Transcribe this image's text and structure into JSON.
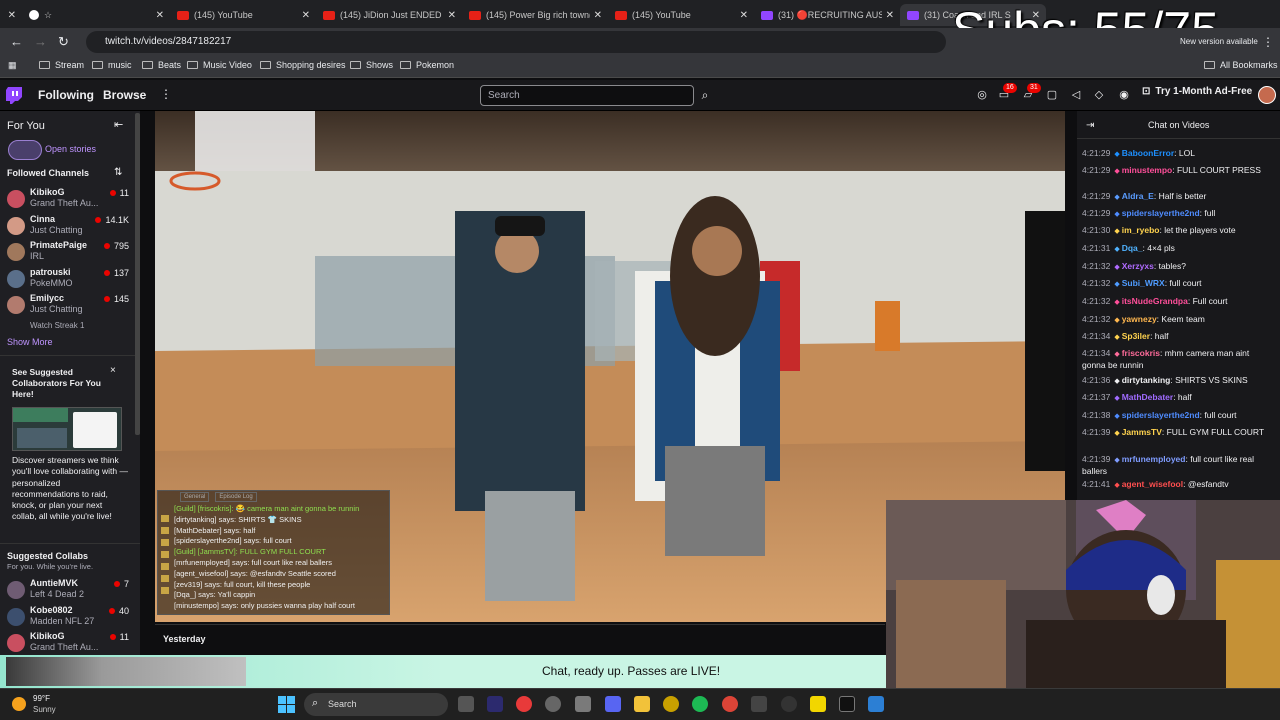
{
  "browser": {
    "tabs": [
      {
        "label": "",
        "kind": "blank"
      },
      {
        "label": "☆",
        "kind": "github"
      },
      {
        "label": "(145) YouTube",
        "kind": "youtube"
      },
      {
        "label": "(145) JiDion Just ENDED Hi",
        "kind": "youtube"
      },
      {
        "label": "(145) Power Big rich town(",
        "kind": "youtube"
      },
      {
        "label": "(145) YouTube",
        "kind": "youtube"
      },
      {
        "label": "(31) 🔴RECRUITING AUSTIN",
        "kind": "twitch"
      },
      {
        "label": "(31) Coach and IRL S",
        "kind": "twitch"
      }
    ],
    "subs_overlay": "Subs: 55/75",
    "new_version": "New version available",
    "url": "twitch.tv/videos/2847182217",
    "bookmarks": [
      "Stream",
      "music",
      "Beats",
      "Music Video",
      "Shopping desires",
      "Shows",
      "Pokemon"
    ],
    "all_bookmarks": "All Bookmarks"
  },
  "twitch_nav": {
    "following": "Following",
    "browse": "Browse",
    "search_placeholder": "Search",
    "notif_inbox": "16",
    "notif_whispers": "31",
    "ad_free": "Try 1-Month Ad-Free"
  },
  "sidebar": {
    "for_you": "For You",
    "open_stories": "Open stories",
    "followed_header": "Followed Channels",
    "followed": [
      {
        "name": "KibikoG",
        "game": "Grand Theft Au...",
        "viewers": "11",
        "color": "#c94f60"
      },
      {
        "name": "Cinna",
        "game": "Just Chatting",
        "viewers": "14.1K",
        "color": "#d39a86"
      },
      {
        "name": "PrimatePaige",
        "game": "IRL",
        "viewers": "795",
        "color": "#a0785c"
      },
      {
        "name": "patrouski",
        "game": "PokeMMO",
        "viewers": "137",
        "color": "#5a6f8a"
      },
      {
        "name": "Emilycc",
        "game": "Just Chatting",
        "viewers": "145",
        "color": "#b27b6e"
      }
    ],
    "watch_streak": "Watch Streak 1",
    "show_more": "Show More",
    "suggest_title": "See Suggested Collaborators For You Here!",
    "suggest_body": "Discover streamers we think you'll love collaborating with — personalized recommendations to raid, knock, or plan your next collab, all while you're live!",
    "suggested_collabs": "Suggested Collabs",
    "suggested_sub": "For you. While you're live.",
    "collabs": [
      {
        "name": "AuntieMVK",
        "game": "Left 4 Dead 2",
        "viewers": "7",
        "color": "#6f5c73"
      },
      {
        "name": "Kobe0802",
        "game": "Madden NFL 27",
        "viewers": "40",
        "color": "#3c4f6e"
      },
      {
        "name": "KibikoG",
        "game": "Grand Theft Au...",
        "viewers": "11",
        "color": "#c94f60"
      }
    ]
  },
  "overlay_chat": {
    "tabs": [
      "General",
      "Episode Log"
    ],
    "lines": [
      "[Guild] [friscokris]: 😂 camera man aint gonna be runnin",
      "[dirtytanking] says: SHIRTS 👕 SKINS",
      "[MathDebater] says: half",
      "[spiderslayerthe2nd] says: full court",
      "[Guild] [JammsTV]: FULL GYM FULL COURT",
      "[mrfunemployed] says: full court like real ballers",
      "[agent_wisefool] says: @esfandtv Seattle scored",
      "[zev319] says: full court, kill these people",
      "[Dqa_] says: Ya'll cappin",
      "[minustempo] says: only pussies wanna play half court"
    ]
  },
  "chat": {
    "title": "Chat on Videos",
    "messages": [
      {
        "ts": "4:21:29",
        "user": "BaboonError",
        "text": "LOL",
        "color": "#1e90ff"
      },
      {
        "ts": "4:21:29",
        "user": "minustempo",
        "text": "FULL COURT PRESS",
        "color": "#ff4f9a"
      },
      {
        "ts": "4:21:29",
        "user": "Aldra_E",
        "text": "Half is better",
        "color": "#5a9cff"
      },
      {
        "ts": "4:21:29",
        "user": "spiderslayerthe2nd",
        "text": "full",
        "color": "#4f8cff"
      },
      {
        "ts": "4:21:30",
        "user": "im_ryebo",
        "text": "let the players vote",
        "color": "#ffd34f"
      },
      {
        "ts": "4:21:31",
        "user": "Dqa_",
        "text": "4×4 pls",
        "color": "#4fb2ff"
      },
      {
        "ts": "4:21:32",
        "user": "Xerzyxs",
        "text": "tables?",
        "color": "#b06bff"
      },
      {
        "ts": "4:21:32",
        "user": "Subi_WRX",
        "text": "full court",
        "color": "#4f9cff"
      },
      {
        "ts": "4:21:32",
        "user": "itsNudeGrandpa",
        "text": "Full court",
        "color": "#ff4f9a"
      },
      {
        "ts": "4:21:32",
        "user": "yawnezy",
        "text": "Keem team",
        "color": "#ffb74f"
      },
      {
        "ts": "4:21:34",
        "user": "Sp3iler",
        "text": "half",
        "color": "#ffd34f"
      },
      {
        "ts": "4:21:34",
        "user": "friscokris",
        "text": "mhm camera man aint gonna be runnin",
        "color": "#ff6b9a"
      },
      {
        "ts": "4:21:36",
        "user": "dirtytanking",
        "text": "SHIRTS VS SKINS",
        "color": "#efeff1"
      },
      {
        "ts": "4:21:37",
        "user": "MathDebater",
        "text": "half",
        "color": "#a06bff"
      },
      {
        "ts": "4:21:38",
        "user": "spiderslayerthe2nd",
        "text": "full court",
        "color": "#4f8cff"
      },
      {
        "ts": "4:21:39",
        "user": "JammsTV",
        "text": "FULL GYM FULL COURT",
        "color": "#ffd34f"
      },
      {
        "ts": "4:21:39",
        "user": "mrfunemployed",
        "text": "full court like real ballers",
        "color": "#7f9cff"
      },
      {
        "ts": "4:21:41",
        "user": "agent_wisefool",
        "text": "@esfandtv",
        "color": "#ff4f4f"
      }
    ]
  },
  "below_video": {
    "yesterday": "Yesterday"
  },
  "promo": {
    "text": "Chat, ready up. Passes are LIVE!"
  },
  "taskbar": {
    "temp": "99°F",
    "weather": "Sunny",
    "search": "Search"
  }
}
